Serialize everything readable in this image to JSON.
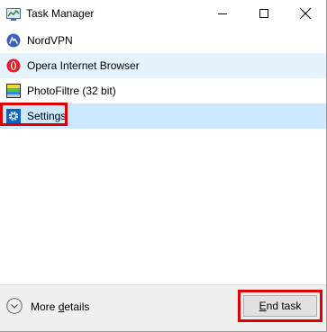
{
  "window": {
    "title": "Task Manager",
    "controls": {
      "minimize": "minimize",
      "maximize": "maximize",
      "close": "close"
    }
  },
  "apps": [
    {
      "label": "NordVPN",
      "icon": "nordvpn-icon",
      "state": "normal"
    },
    {
      "label": "Opera Internet Browser",
      "icon": "opera-icon",
      "state": "hover"
    },
    {
      "label": "PhotoFiltre (32 bit)",
      "icon": "photofiltre-icon",
      "state": "normal"
    },
    {
      "label": "Settings",
      "icon": "settings-gear-icon",
      "state": "selected"
    }
  ],
  "footer": {
    "more_details_prefix": "More ",
    "more_details_underlined": "d",
    "more_details_suffix": "etails",
    "end_task_underlined": "E",
    "end_task_suffix": "nd task"
  },
  "colors": {
    "hover_row": "#e5f3ff",
    "selected_row": "#cce8ff",
    "annotation_red": "#e10000",
    "footer_bg": "#f0f0f0"
  }
}
